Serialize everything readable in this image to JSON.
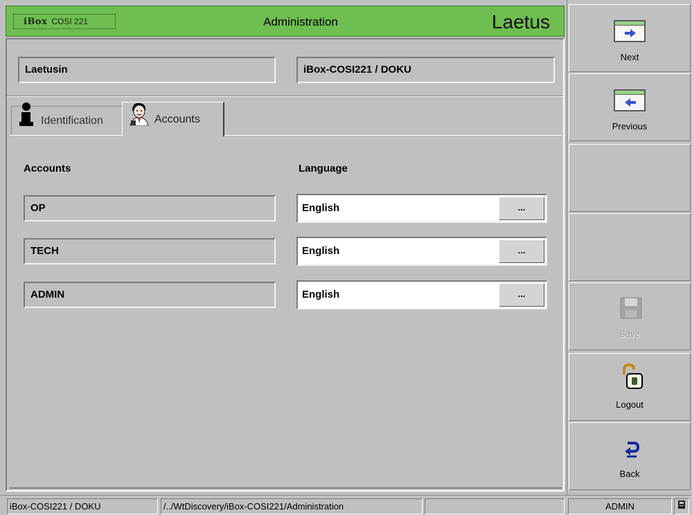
{
  "header": {
    "brand_strong": "iBox",
    "brand_model": "COSI 221",
    "title": "Administration",
    "logo_text": "Laetus",
    "accent_color": "#6fbe51"
  },
  "fields": {
    "site_name": "Laetusin",
    "device_path": "iBox-COSI221 / DOKU"
  },
  "tabs": [
    {
      "label": "Identification",
      "icon": "info-person-icon",
      "active": false
    },
    {
      "label": "Accounts",
      "icon": "user-avatar-icon",
      "active": true
    }
  ],
  "accounts_panel": {
    "accounts_header": "Accounts",
    "language_header": "Language",
    "rows": [
      {
        "account": "OP",
        "language": "English",
        "button": "..."
      },
      {
        "account": "TECH",
        "language": "English",
        "button": "..."
      },
      {
        "account": "ADMIN",
        "language": "English",
        "button": "..."
      }
    ]
  },
  "sidebar": {
    "buttons": [
      {
        "label": "Next",
        "icon": "next-arrow-icon",
        "enabled": true
      },
      {
        "label": "Previous",
        "icon": "previous-arrow-icon",
        "enabled": true
      },
      {
        "label": "",
        "icon": "",
        "enabled": false
      },
      {
        "label": "",
        "icon": "",
        "enabled": false
      },
      {
        "label": "Save",
        "icon": "floppy-disk-icon",
        "enabled": false
      },
      {
        "label": "Logout",
        "icon": "padlock-open-icon",
        "enabled": true
      },
      {
        "label": "Back",
        "icon": "back-return-icon",
        "enabled": true
      }
    ]
  },
  "statusbar": {
    "device": "iBox-COSI221 / DOKU",
    "path": "/../WtDiscovery/iBox-COSI221/Administration",
    "empty": "",
    "user": "ADMIN",
    "indicator_icon": "document-status-icon"
  }
}
